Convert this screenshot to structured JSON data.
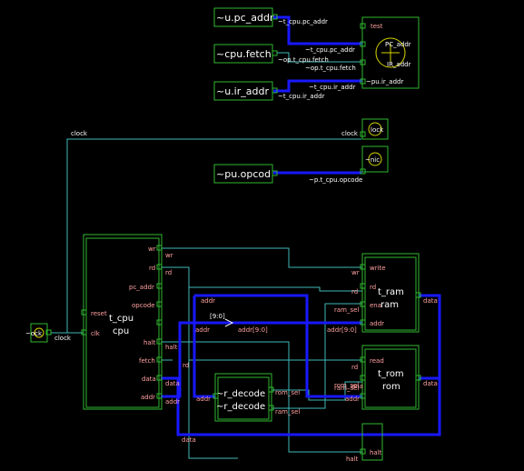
{
  "top_ports": {
    "pc_addr": "~u.pc_addr",
    "fetch": "~cpu.fetch",
    "ir_addr": "~u.ir_addr",
    "opcode": "~pu.opcod",
    "clock_in": "~ock"
  },
  "nets": {
    "pc_addr": "~t_cpu.pc_addr",
    "pc_addr2": "~t_cpu.pc_addr",
    "fetch": "~op.t_cpu.fetch",
    "fetch2": "~op.t_cpu.fetch",
    "ir_addr": "~t_cpu.ir_addr",
    "ir_addr2": "~t_cpu.ir_addr",
    "pu_ir_addr": "~pu.ir_addr",
    "opcode": "~p.t_cpu.opcode",
    "clock": "clock",
    "clock2": "clock",
    "clock3": "clock",
    "addr": "addr",
    "addr_bus": "addr",
    "addr_slice": "[9:0]",
    "addr_slice2": "addr[9:0]",
    "addr_slice3": "addr[9:0]",
    "rom_sel": "rom_sel",
    "ram_sel": "ram_sel",
    "ram_sel2": "ram_sel",
    "data": "data",
    "rd": "rd",
    "wr": "wr",
    "halt": "halt"
  },
  "test_block": {
    "label": "test",
    "pins": [
      "PC_addr",
      "IR_addr"
    ]
  },
  "clock_block": {
    "label": "clock",
    "pin": "lock"
  },
  "opcode_block": {
    "pin": "~nic"
  },
  "cpu": {
    "type": "t_cpu",
    "name": "cpu",
    "pins_left": [
      "reset",
      "clk"
    ],
    "pins_right": [
      "wr",
      "rd",
      "pc_addr",
      "opcode",
      "halt",
      "fetch",
      "data",
      "addr"
    ]
  },
  "ram": {
    "type": "t_ram",
    "name": "ram",
    "pins": [
      "write",
      "rd",
      "ena",
      "addr",
      "data"
    ]
  },
  "rom": {
    "type": "t_rom",
    "name": "rom",
    "pins": [
      "read",
      "rd",
      "ena",
      "addr",
      "data"
    ]
  },
  "decoder": {
    "label1": "~r_decode",
    "label2": "~r_decode",
    "pins": [
      "addr",
      "rom_sel",
      "ram_sel"
    ]
  },
  "halt_block": {
    "label": "halt"
  },
  "colors": {
    "block": "#2fb82f",
    "wire": "#3fb8b8",
    "bus": "#1818ff",
    "label": "#ffa0a0",
    "background": "#000000"
  }
}
